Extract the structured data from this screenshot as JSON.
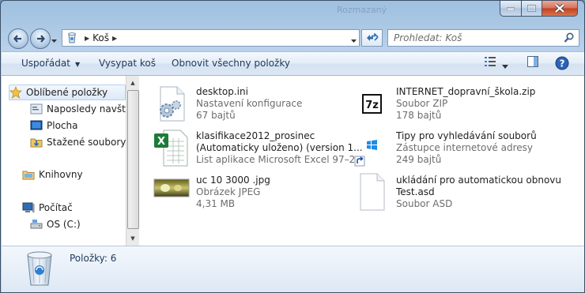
{
  "window": {
    "title": "Rozmazaný"
  },
  "address": {
    "breadcrumb": "Koš"
  },
  "search": {
    "placeholder": "Prohledat: Koš"
  },
  "toolbar": {
    "organize": "Uspořádat",
    "empty_bin": "Vysypat koš",
    "restore_all": "Obnovit všechny položky"
  },
  "nav": {
    "favorites": "Oblíbené položky",
    "recent": "Naposledy navštív",
    "desktop": "Plocha",
    "downloads": "Stažené soubory",
    "libraries": "Knihovny",
    "computer": "Počítač",
    "drive_c": "OS (C:)"
  },
  "files": [
    {
      "name": "desktop.ini",
      "name2": "",
      "type": "Nastavení konfigurace",
      "size": "67 bajtů",
      "icon": "settings-file-icon"
    },
    {
      "name": "INTERNET_dopravní_škola.zip",
      "name2": "",
      "type": "Soubor ZIP",
      "size": "178 bajtů",
      "icon": "7zip-archive-icon"
    },
    {
      "name": "klasifikace2012_prosinec",
      "name2": "(Automaticky uloženo) (version 1...",
      "type": "List aplikace Microsoft Excel 97–2...",
      "size": "",
      "icon": "excel-file-icon"
    },
    {
      "name": "Tipy pro vyhledávání souborů",
      "name2": "",
      "type": "Zástupce internetové adresy",
      "size": "249 bajtů",
      "icon": "internet-shortcut-icon"
    },
    {
      "name": "uc 10 3000 .jpg",
      "name2": "",
      "type": "Obrázek JPEG",
      "size": "4,31 MB",
      "icon": "jpeg-thumbnail-icon"
    },
    {
      "name": "ukládání pro automatickou obnovu",
      "name2": "Test.asd",
      "type": "Soubor ASD",
      "size": "",
      "icon": "generic-file-icon"
    }
  ],
  "status": {
    "items": "Položky: 6"
  },
  "colors": {
    "accent": "#1e395b",
    "excel_green": "#1d7a3a",
    "win_blue": "#1e8ce3"
  }
}
